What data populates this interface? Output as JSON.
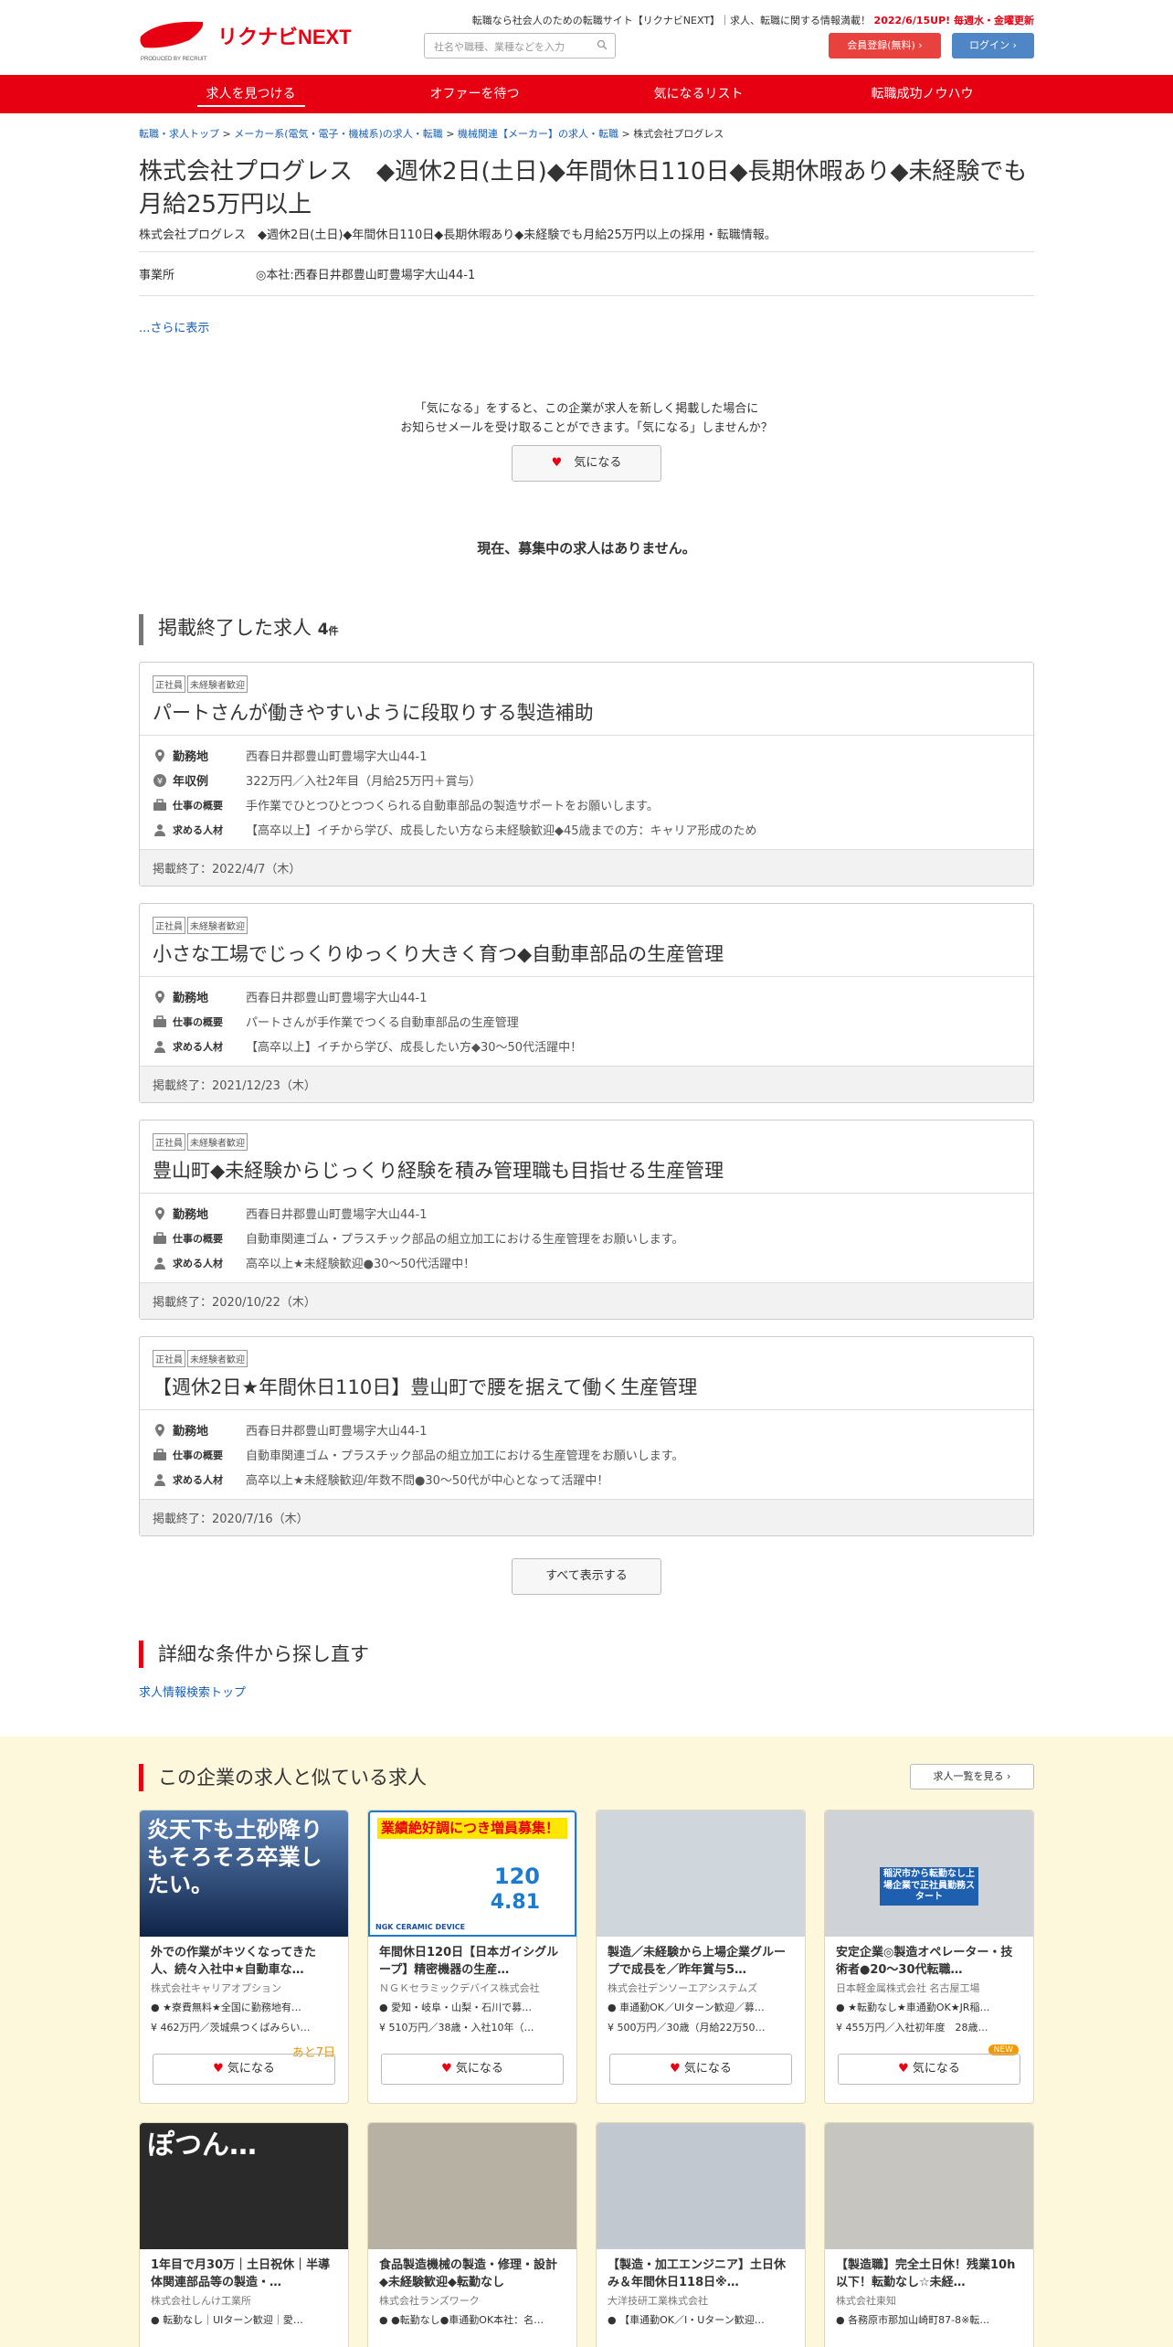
{
  "header": {
    "logo_text": "リクナビNEXT",
    "logo_sub": "PRODUCED BY RECRUIT",
    "tagline": "転職なら社会人のための転職サイト【リクナビNEXT】｜求人、転職に関する情報満載！",
    "update_note": "2022/6/15UP! 毎週水・金曜更新",
    "search_placeholder": "社名や職種、業種などを入力",
    "register_label": "会員登録(無料)",
    "login_label": "ログイン"
  },
  "nav": [
    "求人を見つける",
    "オファーを待つ",
    "気になるリスト",
    "転職成功ノウハウ"
  ],
  "breadcrumb": {
    "items": [
      "転職・求人トップ",
      "メーカー系(電気・電子・機械系)の求人・転職",
      "機械関連【メーカー】の求人・転職"
    ],
    "current": "株式会社プログレス"
  },
  "company": {
    "title": "株式会社プログレス　◆週休2日(土日)◆年間休日110日◆長期休暇あり◆未経験でも月給25万円以上",
    "subtitle": "株式会社プログレス　◆週休2日(土日)◆年間休日110日◆長期休暇あり◆未経験でも月給25万円以上の採用・転職情報。",
    "office_label": "事業所",
    "office_value": "◎本社:西春日井郡豊山町豊場字大山44-1",
    "more": "...さらに表示"
  },
  "favorite": {
    "line1": "「気になる」をすると、この企業が求人を新しく掲載した場合に",
    "line2": "お知らせメールを受け取ることができます。「気になる」しませんか？",
    "button": "気になる"
  },
  "no_jobs": "現在、募集中の求人はありません。",
  "ended": {
    "heading": "掲載終了した求人",
    "count": "4",
    "count_unit": "件",
    "cards": [
      {
        "tags": [
          "正社員",
          "未経験者歓迎"
        ],
        "title": "パートさんが働きやすいように段取りする製造補助",
        "location_label": "勤務地",
        "location": "西春日井郡豊山町豊場字大山44-1",
        "salary_label": "年収例",
        "salary": "322万円／入社2年目（月給25万円＋賞与）",
        "work_label": "仕事の概要",
        "work": "手作業でひとつひとつつくられる自動車部品の製造サポートをお願いします。",
        "req_label": "求める人材",
        "req": "【高卒以上】イチから学び、成長したい方なら未経験歓迎◆45歳までの方：キャリア形成のため",
        "end": "掲載終了：2022/4/7（木）"
      },
      {
        "tags": [
          "正社員",
          "未経験者歓迎"
        ],
        "title": "小さな工場でじっくりゆっくり大きく育つ◆自動車部品の生産管理",
        "location_label": "勤務地",
        "location": "西春日井郡豊山町豊場字大山44-1",
        "work_label": "仕事の概要",
        "work": "パートさんが手作業でつくる自動車部品の生産管理",
        "req_label": "求める人材",
        "req": "【高卒以上】イチから学び、成長したい方◆30～50代活躍中！",
        "end": "掲載終了：2021/12/23（木）"
      },
      {
        "tags": [
          "正社員",
          "未経験者歓迎"
        ],
        "title": "豊山町◆未経験からじっくり経験を積み管理職も目指せる生産管理",
        "location_label": "勤務地",
        "location": "西春日井郡豊山町豊場字大山44-1",
        "work_label": "仕事の概要",
        "work": "自動車関連ゴム・プラスチック部品の組立加工における生産管理をお願いします。",
        "req_label": "求める人材",
        "req": "高卒以上★未経験歓迎●30～50代活躍中！",
        "end": "掲載終了：2020/10/22（木）"
      },
      {
        "tags": [
          "正社員",
          "未経験者歓迎"
        ],
        "title": "【週休2日★年間休日110日】豊山町で腰を据えて働く生産管理",
        "location_label": "勤務地",
        "location": "西春日井郡豊山町豊場字大山44-1",
        "work_label": "仕事の概要",
        "work": "自動車関連ゴム・プラスチック部品の組立加工における生産管理をお願いします。",
        "req_label": "求める人材",
        "req": "高卒以上★未経験歓迎/年数不問●30～50代が中心となって活躍中！",
        "end": "掲載終了：2020/7/16（木）"
      }
    ],
    "show_all": "すべて表示する"
  },
  "research": {
    "heading": "詳細な条件から探し直す",
    "link": "求人情報検索トップ"
  },
  "similar": {
    "heading": "この企業の求人と似ている求人",
    "list_link": "求人一覧を見る",
    "fav_label": "気になる",
    "cards": [
      {
        "title": "外での作業がキツくなってきた人、続々入社中★自動車な…",
        "company": "株式会社キャリアオプション",
        "loc": "★寮費無料★全国に勤務地有…",
        "salary": "462万円／茨城県つくばみらい…",
        "extra": "あと7日",
        "img_text": "炎天下も土砂降りもそろそろ卒業したい。"
      },
      {
        "title": "年間休日120日【日本ガイシグループ】精密機器の生産…",
        "company": "ＮＧＫセラミックデバイス株式会社",
        "loc": "愛知・岐阜・山梨・石川で募…",
        "salary": "510万円／38歳・入社10年（…",
        "img_text": "業績絶好調につき増員募集！",
        "img_sub": "NGK CERAMIC DEVICE",
        "img_num1": "120",
        "img_num2": "4.81"
      },
      {
        "title": "製造／未経験から上場企業グループで成長を／昨年賞与5…",
        "company": "株式会社デンソーエアシステムズ",
        "loc": "車通勤OK／UIターン歓迎／募…",
        "salary": "500万円／30歳（月給22万50…"
      },
      {
        "title": "安定企業◎製造オペレーター・技術者●20～30代転職…",
        "company": "日本軽金属株式会社 名古屋工場",
        "loc": "★転勤なし★車通勤OK★JR稲…",
        "salary": "455万円／入社初年度　28歳…",
        "badge": "NEW",
        "img_text": "稲沢市から転勤なし上場企業で正社員勤務スタート"
      },
      {
        "title": "1年目で月30万｜土日祝休｜半導体関連部品等の製造・…",
        "company": "株式会社しんけ工業所",
        "loc": "転勤なし｜UIターン歓迎｜愛…",
        "img_text": "ぽつん…"
      },
      {
        "title": "食品製造機械の製造・修理・設計◆未経験歓迎◆転勤なし",
        "company": "株式会社ランズワーク",
        "loc": "●転勤なし●車通勤OK本社：名…"
      },
      {
        "title": "【製造・加工エンジニア】土日休み＆年間休日118日※…",
        "company": "大洋技研工業株式会社",
        "loc": "【車通勤OK／I・Uターン歓迎…"
      },
      {
        "title": "【製造職】完全土日休！残業10h以下！転勤なし☆未経…",
        "company": "株式会社東知",
        "loc": "各務原市那加山崎町87-8※転…"
      }
    ]
  },
  "colors": {
    "brand_red": "#e60012",
    "link_blue": "#1a5fb4",
    "login_blue": "#4f86c6",
    "similar_bg": "#fdf7dc"
  }
}
